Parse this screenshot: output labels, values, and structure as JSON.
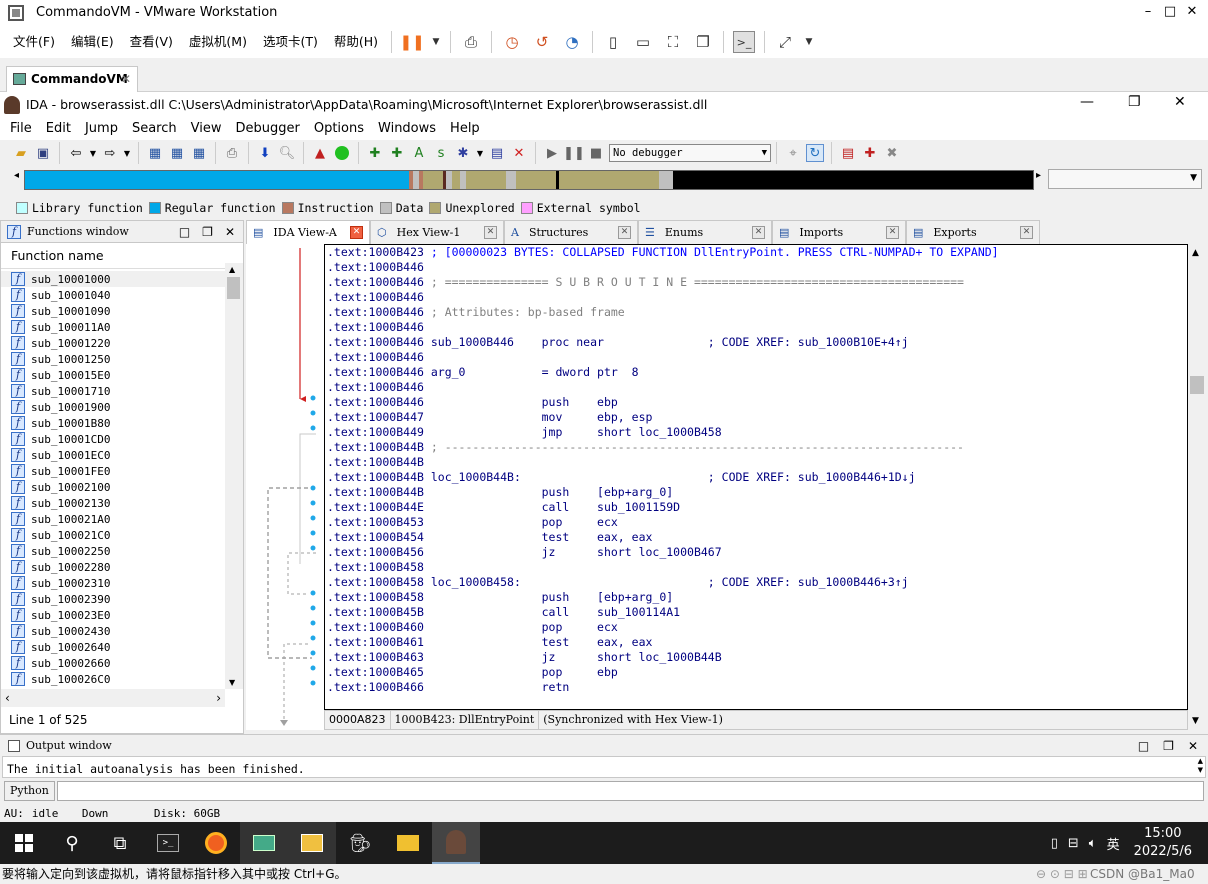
{
  "vmware": {
    "title": "CommandoVM - VMware Workstation",
    "menu": [
      "文件(F)",
      "编辑(E)",
      "查看(V)",
      "虚拟机(M)",
      "选项卡(T)",
      "帮助(H)"
    ],
    "tab": "CommandoVM",
    "status": "要将输入定向到该虚拟机，请将鼠标指针移入其中或按 Ctrl+G。"
  },
  "ida": {
    "title": "IDA - browserassist.dll C:\\Users\\Administrator\\AppData\\Roaming\\Microsoft\\Internet Explorer\\browserassist.dll",
    "menu": [
      "File",
      "Edit",
      "Jump",
      "Search",
      "View",
      "Debugger",
      "Options",
      "Windows",
      "Help"
    ],
    "debugger": "No debugger",
    "legend": [
      {
        "label": "Library function",
        "color": "#c0ffff"
      },
      {
        "label": "Regular function",
        "color": "#00a8e8"
      },
      {
        "label": "Instruction",
        "color": "#b87860"
      },
      {
        "label": "Data",
        "color": "#c0c0c0"
      },
      {
        "label": "Unexplored",
        "color": "#b0a870"
      },
      {
        "label": "External symbol",
        "color": "#ffa0ff"
      }
    ],
    "functions": {
      "title": "Functions window",
      "header": "Function name",
      "footer": "Line 1 of 525",
      "items": [
        "sub_10001000",
        "sub_10001040",
        "sub_10001090",
        "sub_100011A0",
        "sub_10001220",
        "sub_10001250",
        "sub_100015E0",
        "sub_10001710",
        "sub_10001900",
        "sub_10001B80",
        "sub_10001CD0",
        "sub_10001EC0",
        "sub_10001FE0",
        "sub_10002100",
        "sub_10002130",
        "sub_100021A0",
        "sub_100021C0",
        "sub_10002250",
        "sub_10002280",
        "sub_10002310",
        "sub_10002390",
        "sub_100023E0",
        "sub_10002430",
        "sub_10002640",
        "sub_10002660",
        "sub_100026C0"
      ]
    },
    "tabs": [
      {
        "label": "IDA View-A",
        "active": true
      },
      {
        "label": "Hex View-1"
      },
      {
        "label": "Structures"
      },
      {
        "label": "Enums"
      },
      {
        "label": "Imports"
      },
      {
        "label": "Exports"
      }
    ],
    "code": [
      {
        "a": ".text:1000B423",
        "t": " ; [00000023 BYTES: COLLAPSED FUNCTION DllEntryPoint. PRESS CTRL-NUMPAD+ TO EXPAND]",
        "k": "lbl"
      },
      {
        "a": ".text:1000B446",
        "t": ""
      },
      {
        "a": ".text:1000B446",
        "t": " ; =============== S U B R O U T I N E =======================================",
        "k": "cm"
      },
      {
        "a": ".text:1000B446",
        "t": ""
      },
      {
        "a": ".text:1000B446",
        "t": " ; Attributes: bp-based frame",
        "k": "cm"
      },
      {
        "a": ".text:1000B446",
        "t": ""
      },
      {
        "a": ".text:1000B446",
        "t": " sub_1000B446    proc near               ; CODE XREF: sub_1000B10E+4↑j",
        "k": "ins"
      },
      {
        "a": ".text:1000B446",
        "t": ""
      },
      {
        "a": ".text:1000B446",
        "t": " arg_0           = dword ptr  8",
        "k": "ins"
      },
      {
        "a": ".text:1000B446",
        "t": ""
      },
      {
        "a": ".text:1000B446",
        "t": "                 push    ebp",
        "k": "ins"
      },
      {
        "a": ".text:1000B447",
        "t": "                 mov     ebp, esp",
        "k": "ins"
      },
      {
        "a": ".text:1000B449",
        "t": "                 jmp     short loc_1000B458",
        "k": "ins"
      },
      {
        "a": ".text:1000B44B",
        "t": " ; ---------------------------------------------------------------------------",
        "k": "cm"
      },
      {
        "a": ".text:1000B44B",
        "t": ""
      },
      {
        "a": ".text:1000B44B",
        "t": " loc_1000B44B:                           ; CODE XREF: sub_1000B446+1D↓j",
        "k": "ins"
      },
      {
        "a": ".text:1000B44B",
        "t": "                 push    [ebp+arg_0]",
        "k": "ins"
      },
      {
        "a": ".text:1000B44E",
        "t": "                 call    sub_1001159D",
        "k": "ins"
      },
      {
        "a": ".text:1000B453",
        "t": "                 pop     ecx",
        "k": "ins"
      },
      {
        "a": ".text:1000B454",
        "t": "                 test    eax, eax",
        "k": "ins"
      },
      {
        "a": ".text:1000B456",
        "t": "                 jz      short loc_1000B467",
        "k": "ins"
      },
      {
        "a": ".text:1000B458",
        "t": ""
      },
      {
        "a": ".text:1000B458",
        "t": " loc_1000B458:                           ; CODE XREF: sub_1000B446+3↑j",
        "k": "ins"
      },
      {
        "a": ".text:1000B458",
        "t": "                 push    [ebp+arg_0]",
        "k": "ins"
      },
      {
        "a": ".text:1000B45B",
        "t": "                 call    sub_100114A1",
        "k": "ins"
      },
      {
        "a": ".text:1000B460",
        "t": "                 pop     ecx",
        "k": "ins"
      },
      {
        "a": ".text:1000B461",
        "t": "                 test    eax, eax",
        "k": "ins"
      },
      {
        "a": ".text:1000B463",
        "t": "                 jz      short loc_1000B44B",
        "k": "ins"
      },
      {
        "a": ".text:1000B465",
        "t": "                 pop     ebp",
        "k": "ins"
      },
      {
        "a": ".text:1000B466",
        "t": "                 retn",
        "k": "ins"
      }
    ],
    "code_status": [
      "0000A823",
      "1000B423: DllEntryPoint",
      "(Synchronized with Hex View-1)"
    ],
    "output": {
      "title": "Output window",
      "text": "The initial autoanalysis has been finished.",
      "python": "Python"
    },
    "status": {
      "au": "AU:",
      "state": "idle",
      "dir": "Down",
      "disk": "Disk: 60GB"
    }
  },
  "taskbar": {
    "time": "15:00",
    "date": "2022/5/6",
    "ime": "英",
    "watermark": "CSDN @Ba1_Ma0"
  }
}
